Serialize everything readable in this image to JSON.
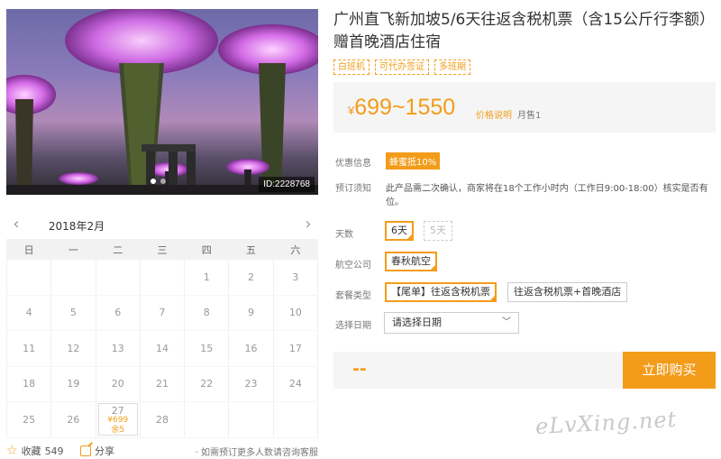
{
  "photo": {
    "id_label": "ID:2228768",
    "slide_count": 2,
    "active_slide": 1
  },
  "calendar": {
    "month": "2018年2月",
    "weekdays": [
      "日",
      "一",
      "二",
      "三",
      "四",
      "五",
      "六"
    ],
    "weeks": [
      [
        "",
        "",
        "",
        "",
        "1",
        "2",
        "3"
      ],
      [
        "4",
        "5",
        "6",
        "7",
        "8",
        "9",
        "10"
      ],
      [
        "11",
        "12",
        "13",
        "14",
        "15",
        "16",
        "17"
      ],
      [
        "18",
        "19",
        "20",
        "21",
        "22",
        "23",
        "24"
      ],
      [
        "25",
        "26",
        "27",
        "28",
        "",
        "",
        ""
      ]
    ],
    "available": {
      "day": "27",
      "price": "¥699",
      "stock": "余5"
    }
  },
  "bottom": {
    "fav_label": "收藏",
    "fav_count": "549",
    "share_label": "分享",
    "more_note": "· 如需预订更多人数请咨询客服"
  },
  "product": {
    "title": "广州直飞新加坡5/6天往返含税机票（含15公斤行李额）赠首晚酒店住宿",
    "tags": [
      "白班机",
      "可代办签证",
      "多班期"
    ],
    "price_yen": "¥",
    "price_range": "699~1550",
    "price_note": "价格说明",
    "sold": "月售1"
  },
  "info": {
    "discount_label": "优惠信息",
    "discount_badge": "蜂蜜抵10%",
    "notice_label": "预订须知",
    "notice_text": "此产品需二次确认，商家将在18个工作小时内（工作日9:00-18:00）核实是否有位。"
  },
  "options": {
    "days_label": "天数",
    "days": [
      {
        "label": "6天",
        "state": "selected"
      },
      {
        "label": "5天",
        "state": "disabled"
      }
    ],
    "airline_label": "航空公司",
    "airline": "春秋航空",
    "package_label": "套餐类型",
    "packages": [
      {
        "label": "【尾单】往返含税机票",
        "state": "selected"
      },
      {
        "label": "往返含税机票+首晚酒店",
        "state": "normal"
      }
    ],
    "date_label": "选择日期",
    "date_placeholder": "请选择日期"
  },
  "buy": {
    "price_placeholder": "--",
    "button": "立即购买"
  },
  "watermark": "eLvXing.net",
  "colors": {
    "accent": "#f39c1a",
    "panel_bg": "#f5f5f5"
  }
}
